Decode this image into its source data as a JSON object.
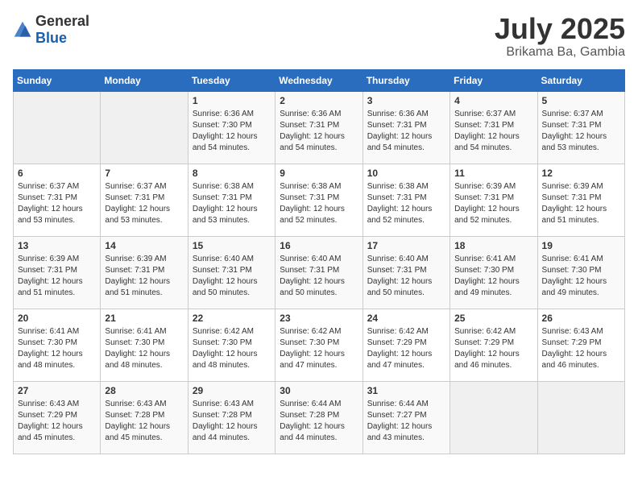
{
  "header": {
    "logo_general": "General",
    "logo_blue": "Blue",
    "month": "July 2025",
    "location": "Brikama Ba, Gambia"
  },
  "weekdays": [
    "Sunday",
    "Monday",
    "Tuesday",
    "Wednesday",
    "Thursday",
    "Friday",
    "Saturday"
  ],
  "weeks": [
    [
      {
        "day": "",
        "info": ""
      },
      {
        "day": "",
        "info": ""
      },
      {
        "day": "1",
        "info": "Sunrise: 6:36 AM\nSunset: 7:30 PM\nDaylight: 12 hours and 54 minutes."
      },
      {
        "day": "2",
        "info": "Sunrise: 6:36 AM\nSunset: 7:31 PM\nDaylight: 12 hours and 54 minutes."
      },
      {
        "day": "3",
        "info": "Sunrise: 6:36 AM\nSunset: 7:31 PM\nDaylight: 12 hours and 54 minutes."
      },
      {
        "day": "4",
        "info": "Sunrise: 6:37 AM\nSunset: 7:31 PM\nDaylight: 12 hours and 54 minutes."
      },
      {
        "day": "5",
        "info": "Sunrise: 6:37 AM\nSunset: 7:31 PM\nDaylight: 12 hours and 53 minutes."
      }
    ],
    [
      {
        "day": "6",
        "info": "Sunrise: 6:37 AM\nSunset: 7:31 PM\nDaylight: 12 hours and 53 minutes."
      },
      {
        "day": "7",
        "info": "Sunrise: 6:37 AM\nSunset: 7:31 PM\nDaylight: 12 hours and 53 minutes."
      },
      {
        "day": "8",
        "info": "Sunrise: 6:38 AM\nSunset: 7:31 PM\nDaylight: 12 hours and 53 minutes."
      },
      {
        "day": "9",
        "info": "Sunrise: 6:38 AM\nSunset: 7:31 PM\nDaylight: 12 hours and 52 minutes."
      },
      {
        "day": "10",
        "info": "Sunrise: 6:38 AM\nSunset: 7:31 PM\nDaylight: 12 hours and 52 minutes."
      },
      {
        "day": "11",
        "info": "Sunrise: 6:39 AM\nSunset: 7:31 PM\nDaylight: 12 hours and 52 minutes."
      },
      {
        "day": "12",
        "info": "Sunrise: 6:39 AM\nSunset: 7:31 PM\nDaylight: 12 hours and 51 minutes."
      }
    ],
    [
      {
        "day": "13",
        "info": "Sunrise: 6:39 AM\nSunset: 7:31 PM\nDaylight: 12 hours and 51 minutes."
      },
      {
        "day": "14",
        "info": "Sunrise: 6:39 AM\nSunset: 7:31 PM\nDaylight: 12 hours and 51 minutes."
      },
      {
        "day": "15",
        "info": "Sunrise: 6:40 AM\nSunset: 7:31 PM\nDaylight: 12 hours and 50 minutes."
      },
      {
        "day": "16",
        "info": "Sunrise: 6:40 AM\nSunset: 7:31 PM\nDaylight: 12 hours and 50 minutes."
      },
      {
        "day": "17",
        "info": "Sunrise: 6:40 AM\nSunset: 7:31 PM\nDaylight: 12 hours and 50 minutes."
      },
      {
        "day": "18",
        "info": "Sunrise: 6:41 AM\nSunset: 7:30 PM\nDaylight: 12 hours and 49 minutes."
      },
      {
        "day": "19",
        "info": "Sunrise: 6:41 AM\nSunset: 7:30 PM\nDaylight: 12 hours and 49 minutes."
      }
    ],
    [
      {
        "day": "20",
        "info": "Sunrise: 6:41 AM\nSunset: 7:30 PM\nDaylight: 12 hours and 48 minutes."
      },
      {
        "day": "21",
        "info": "Sunrise: 6:41 AM\nSunset: 7:30 PM\nDaylight: 12 hours and 48 minutes."
      },
      {
        "day": "22",
        "info": "Sunrise: 6:42 AM\nSunset: 7:30 PM\nDaylight: 12 hours and 48 minutes."
      },
      {
        "day": "23",
        "info": "Sunrise: 6:42 AM\nSunset: 7:30 PM\nDaylight: 12 hours and 47 minutes."
      },
      {
        "day": "24",
        "info": "Sunrise: 6:42 AM\nSunset: 7:29 PM\nDaylight: 12 hours and 47 minutes."
      },
      {
        "day": "25",
        "info": "Sunrise: 6:42 AM\nSunset: 7:29 PM\nDaylight: 12 hours and 46 minutes."
      },
      {
        "day": "26",
        "info": "Sunrise: 6:43 AM\nSunset: 7:29 PM\nDaylight: 12 hours and 46 minutes."
      }
    ],
    [
      {
        "day": "27",
        "info": "Sunrise: 6:43 AM\nSunset: 7:29 PM\nDaylight: 12 hours and 45 minutes."
      },
      {
        "day": "28",
        "info": "Sunrise: 6:43 AM\nSunset: 7:28 PM\nDaylight: 12 hours and 45 minutes."
      },
      {
        "day": "29",
        "info": "Sunrise: 6:43 AM\nSunset: 7:28 PM\nDaylight: 12 hours and 44 minutes."
      },
      {
        "day": "30",
        "info": "Sunrise: 6:44 AM\nSunset: 7:28 PM\nDaylight: 12 hours and 44 minutes."
      },
      {
        "day": "31",
        "info": "Sunrise: 6:44 AM\nSunset: 7:27 PM\nDaylight: 12 hours and 43 minutes."
      },
      {
        "day": "",
        "info": ""
      },
      {
        "day": "",
        "info": ""
      }
    ]
  ]
}
